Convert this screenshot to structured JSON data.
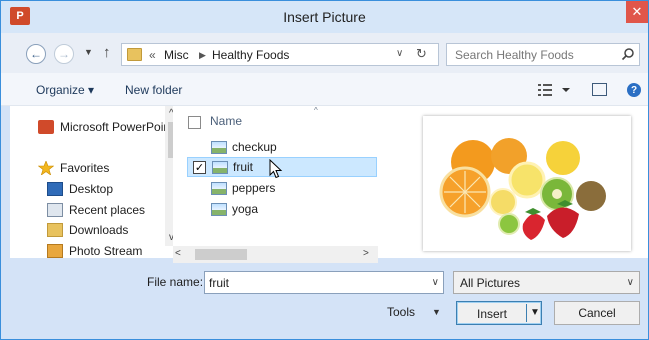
{
  "window": {
    "title": "Insert Picture",
    "app_icon": "powerpoint-icon",
    "close_glyph": "✕"
  },
  "nav": {
    "back_glyph": "←",
    "forward_glyph": "→",
    "recent_glyph": "▼",
    "up_glyph": "↑",
    "breadcrumb": {
      "overflow": "«",
      "items": [
        "Misc",
        "Healthy Foods"
      ],
      "sep": "▶"
    },
    "dropdown_glyph": "∨",
    "refresh_glyph": "↻",
    "search_placeholder": "Search Healthy Foods"
  },
  "toolbar": {
    "organize": "Organize ▾",
    "new_folder": "New folder",
    "help_glyph": "?"
  },
  "sidebar": {
    "items": [
      {
        "label": "Microsoft PowerPoint",
        "icon": "powerpoint-icon"
      },
      {
        "label": "Favorites",
        "icon": "star-icon"
      },
      {
        "label": "Desktop",
        "icon": "desktop-icon"
      },
      {
        "label": "Recent places",
        "icon": "recent-places-icon"
      },
      {
        "label": "Downloads",
        "icon": "downloads-icon"
      },
      {
        "label": "Photo Stream",
        "icon": "photo-stream-icon"
      }
    ]
  },
  "files": {
    "column_name": "Name",
    "sort_glyph": "^",
    "rows": [
      {
        "name": "checkup",
        "checked": false
      },
      {
        "name": "fruit",
        "checked": true,
        "selected": true
      },
      {
        "name": "peppers",
        "checked": false
      },
      {
        "name": "yoga",
        "checked": false
      }
    ],
    "check_glyph": "✓"
  },
  "scroll": {
    "left_glyph": "<",
    "right_glyph": ">",
    "up_glyph": "^",
    "down_glyph": "v"
  },
  "bottom": {
    "filename_label": "File name:",
    "filename_value": "fruit",
    "filetype_value": "All Pictures",
    "dd_glyph": "∨",
    "tools_label": "Tools",
    "tools_dd": "▼",
    "insert_label": "Insert",
    "insert_dd": "▼",
    "cancel_label": "Cancel"
  },
  "colors": {
    "accent": "#3a8fdc",
    "selection": "#cce8ff",
    "chrome": "#d4e3f7"
  }
}
